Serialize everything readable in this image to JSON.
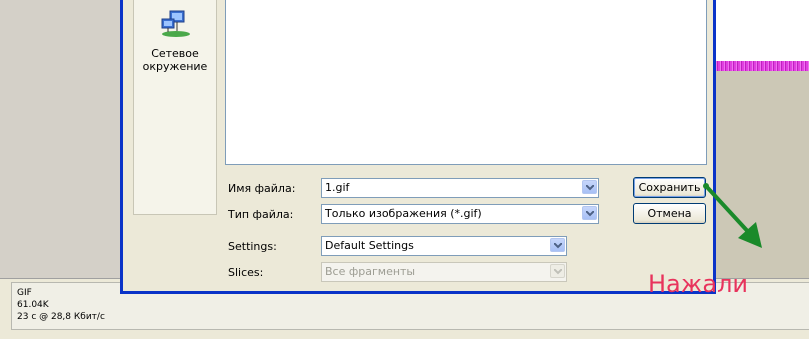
{
  "places": {
    "network_label_line1": "Сетевое",
    "network_label_line2": "окружение",
    "network_icon": "network-places-icon"
  },
  "form": {
    "filename_label": "Имя файла:",
    "filename_value": "1.gif",
    "filetype_label": "Тип файла:",
    "filetype_value": "Только изображения (*.gif)",
    "settings_label": "Settings:",
    "settings_value": "Default Settings",
    "slices_label": "Slices:",
    "slices_value": "Все фрагменты"
  },
  "buttons": {
    "save": "Сохранить",
    "cancel": "Отмена"
  },
  "status": {
    "format": "GIF",
    "size": "61.04K",
    "speed": "23 с @ 28,8 Кбит/с"
  },
  "annotation": {
    "text": "Нажали",
    "color": "#e8335c",
    "arrow_color": "#1a8a2a"
  }
}
